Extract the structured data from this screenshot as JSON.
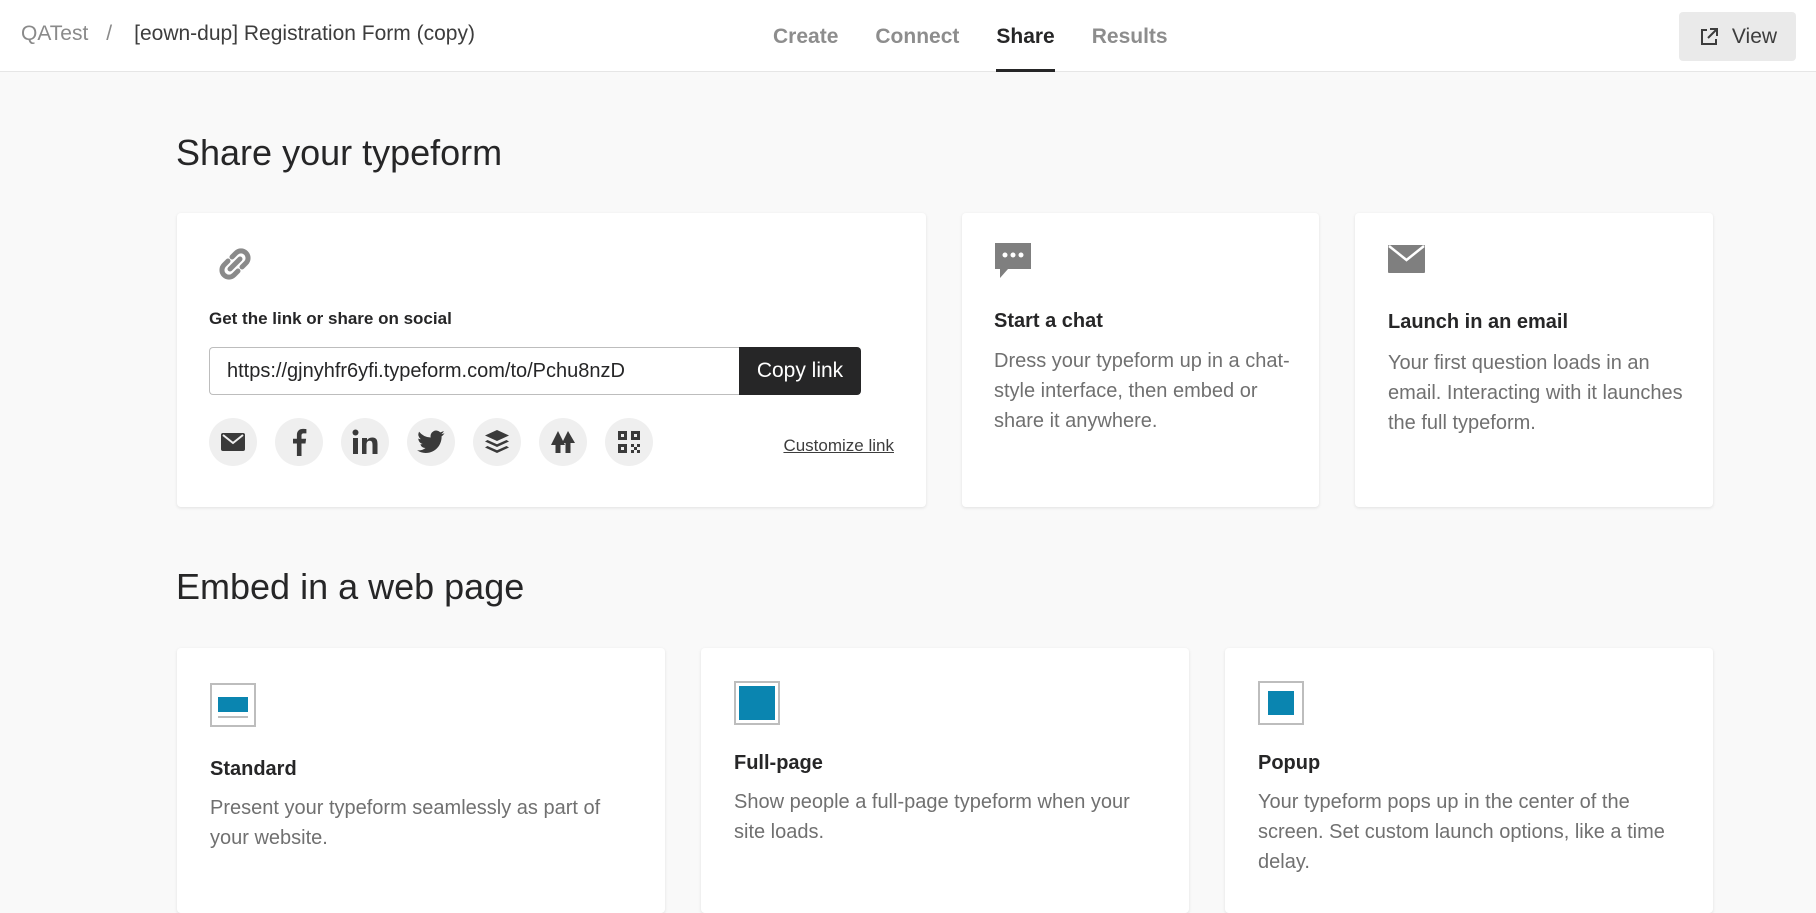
{
  "header": {
    "workspace": "QATest",
    "separator": "/",
    "form_name": "[eown-dup] Registration Form (copy)",
    "tabs": [
      {
        "label": "Create",
        "active": false
      },
      {
        "label": "Connect",
        "active": false
      },
      {
        "label": "Share",
        "active": true
      },
      {
        "label": "Results",
        "active": false
      }
    ],
    "view_label": "View"
  },
  "share": {
    "title": "Share your typeform",
    "link_card": {
      "label": "Get the link or share on social",
      "url": "https://gjnyhfr6yfi.typeform.com/to/Pchu8nzD",
      "copy_label": "Copy link",
      "customize_label": "Customize link",
      "social_icons": [
        "mail-icon",
        "facebook-icon",
        "linkedin-icon",
        "twitter-icon",
        "buffer-icon",
        "linktree-icon",
        "qr-code-icon"
      ]
    },
    "chat_card": {
      "title": "Start a chat",
      "description": "Dress your typeform up in a chat-style interface, then embed or share it anywhere."
    },
    "email_card": {
      "title": "Launch in an email",
      "description": "Your first question loads in an email. Interacting with it launches the full typeform."
    }
  },
  "embed": {
    "title": "Embed in a web page",
    "cards": [
      {
        "title": "Standard",
        "description": "Present your typeform seamlessly as part of your website."
      },
      {
        "title": "Full-page",
        "description": "Show people a full-page typeform when your site loads."
      },
      {
        "title": "Popup",
        "description": "Your typeform pops up in the center of the screen. Set custom launch options, like a time delay."
      }
    ]
  },
  "colors": {
    "accent": "#0a85b0",
    "dark": "#262627",
    "icon_gray": "#7f7f7f"
  }
}
